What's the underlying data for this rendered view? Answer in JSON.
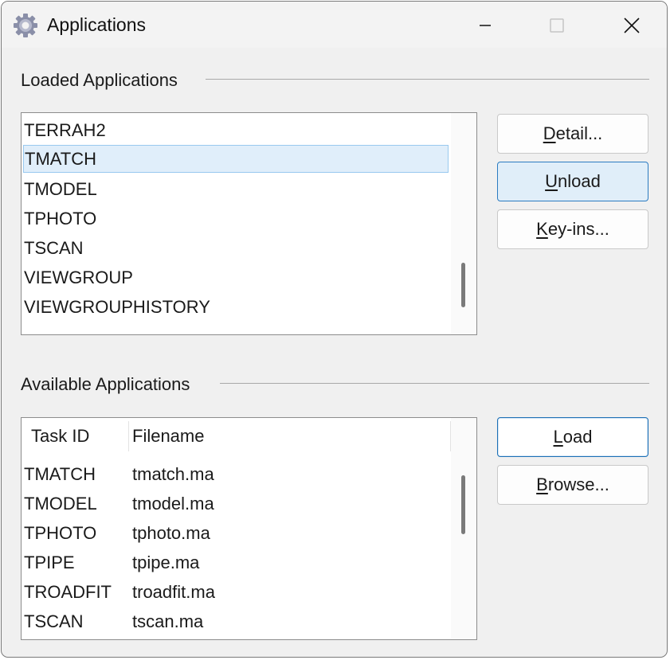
{
  "window": {
    "title": "Applications"
  },
  "loaded": {
    "label": "Loaded Applications",
    "items": [
      "TERRAH2",
      "TMATCH",
      "TMODEL",
      "TPHOTO",
      "TSCAN",
      "VIEWGROUP",
      "VIEWGROUPHISTORY"
    ],
    "selected_index": 1,
    "buttons": {
      "detail_u": "D",
      "detail_rest": "etail...",
      "unload_u": "U",
      "unload_rest": "nload",
      "keyins_u": "K",
      "keyins_rest": "ey-ins..."
    }
  },
  "available": {
    "label": "Available Applications",
    "columns": [
      "Task ID",
      "Filename"
    ],
    "rows": [
      [
        "TMATCH",
        "tmatch.ma"
      ],
      [
        "TMODEL",
        "tmodel.ma"
      ],
      [
        "TPHOTO",
        "tphoto.ma"
      ],
      [
        "TPIPE",
        "tpipe.ma"
      ],
      [
        "TROADFIT",
        "troadfit.ma"
      ],
      [
        "TSCAN",
        "tscan.ma"
      ]
    ],
    "buttons": {
      "load_u": "L",
      "load_rest": "oad",
      "browse_u": "B",
      "browse_rest": "rowse..."
    }
  },
  "icons": {
    "app": "gear-icon",
    "minimize": "minimize-icon",
    "maximize": "maximize-icon",
    "close": "close-icon"
  },
  "colors": {
    "selection_bg": "#e0eefa",
    "selection_border": "#99c9ef",
    "default_button_border": "#1c6fb5"
  }
}
